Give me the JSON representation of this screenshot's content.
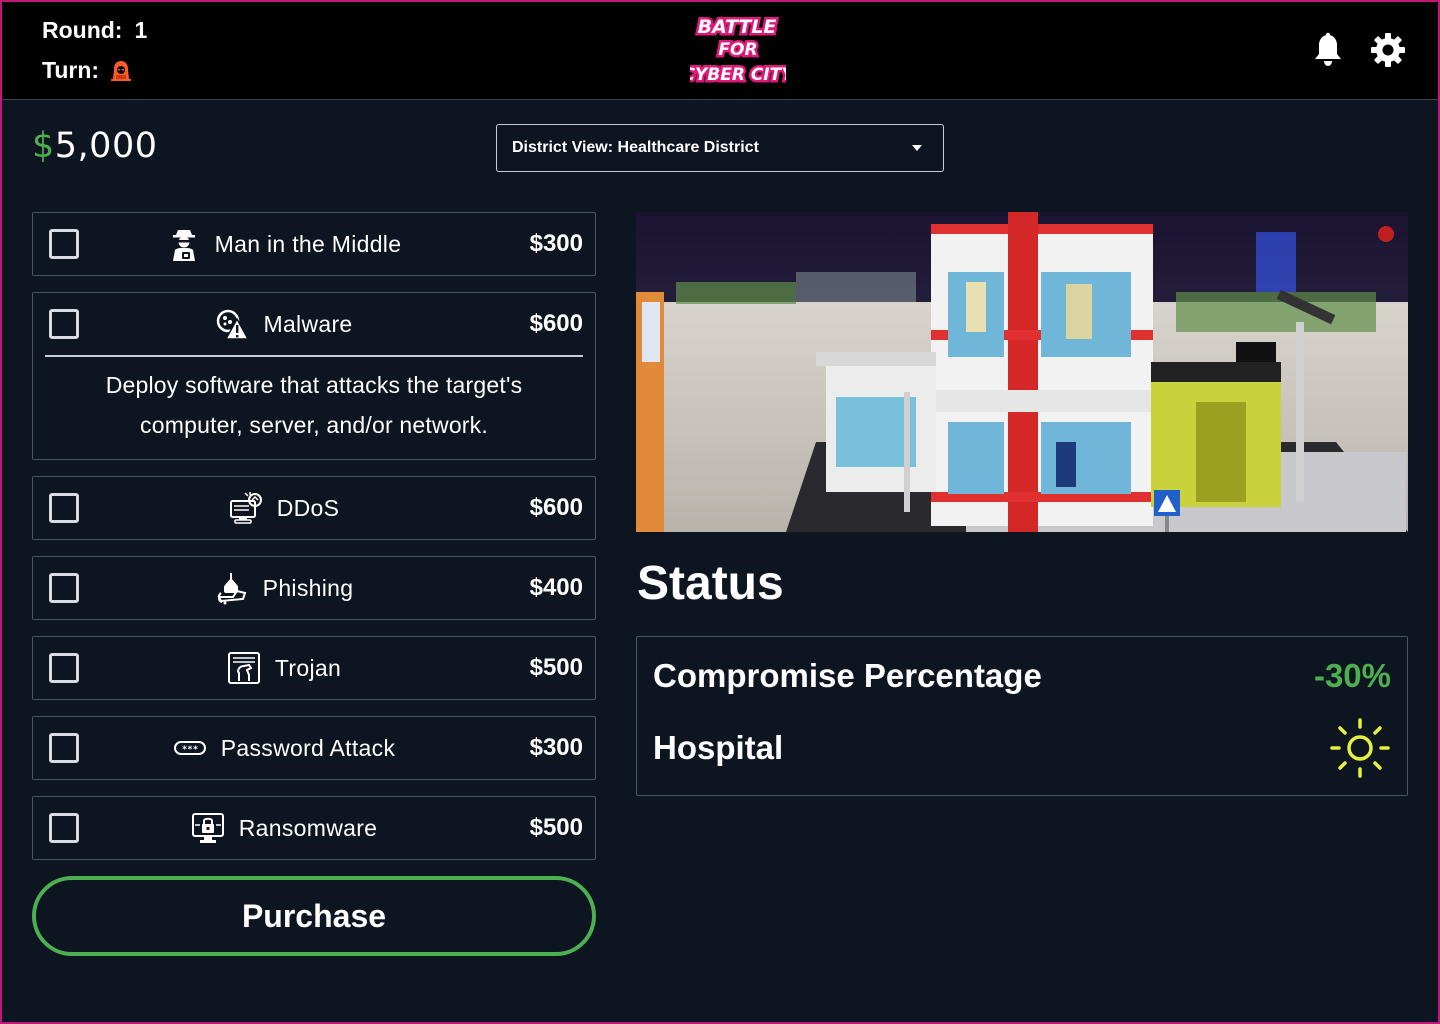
{
  "header": {
    "round_label": "Round:",
    "round_value": "1",
    "turn_label": "Turn:",
    "turn_icon": "hacker-icon",
    "logo_lines": [
      "BATTLE",
      "FOR",
      "CYBER CITY"
    ],
    "icons": [
      "bell-icon",
      "gear-icon"
    ]
  },
  "money": {
    "currency": "$",
    "amount": "5,000"
  },
  "district_select": {
    "value": "District View: Healthcare  District"
  },
  "attacks": [
    {
      "name": "Man in the Middle",
      "price": "$300",
      "icon": "spy-icon",
      "checked": false
    },
    {
      "name": "Malware",
      "price": "$600",
      "icon": "malware-warning-icon",
      "checked": false,
      "expanded": true,
      "description": "Deploy software that attacks the target's computer, server, and/or network."
    },
    {
      "name": "DDoS",
      "price": "$600",
      "icon": "ddos-computer-icon",
      "checked": false
    },
    {
      "name": "Phishing",
      "price": "$400",
      "icon": "phishing-hook-icon",
      "checked": false
    },
    {
      "name": "Trojan",
      "price": "$500",
      "icon": "trojan-horse-icon",
      "checked": false
    },
    {
      "name": "Password Attack",
      "price": "$300",
      "icon": "password-key-icon",
      "checked": false
    },
    {
      "name": "Ransomware",
      "price": "$500",
      "icon": "ransomware-lock-icon",
      "checked": false
    }
  ],
  "purchase_label": "Purchase",
  "status": {
    "title": "Status",
    "compromise_label": "Compromise Percentage",
    "compromise_value": "-30%",
    "facility_label": "Hospital",
    "facility_icon": "sun-icon"
  },
  "colors": {
    "background": "#0d1520",
    "header": "#000000",
    "accent_green": "#4caf50",
    "sun_yellow": "#e6f03c",
    "frame": "#c0187a"
  }
}
